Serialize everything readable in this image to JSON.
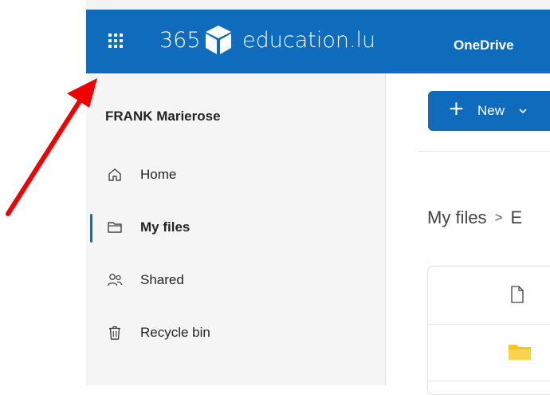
{
  "header": {
    "brand_prefix": "365",
    "brand_domain": "education.lu",
    "app_name": "OneDrive"
  },
  "sidebar": {
    "user_name": "FRANK Marierose",
    "items": [
      {
        "label": "Home",
        "icon": "home-icon"
      },
      {
        "label": "My files",
        "icon": "folder-icon",
        "selected": true
      },
      {
        "label": "Shared",
        "icon": "people-icon"
      },
      {
        "label": "Recycle bin",
        "icon": "trash-icon"
      }
    ]
  },
  "toolbar": {
    "new_label": "New"
  },
  "breadcrumb": {
    "root": "My files",
    "separator": ">",
    "next_partial": "E"
  },
  "colors": {
    "header_bg": "#0f6cbd",
    "sidebar_bg": "#f5f5f5",
    "accent": "#0f6cbd",
    "annotation_arrow": "#f00000",
    "folder": "#f5c518"
  }
}
